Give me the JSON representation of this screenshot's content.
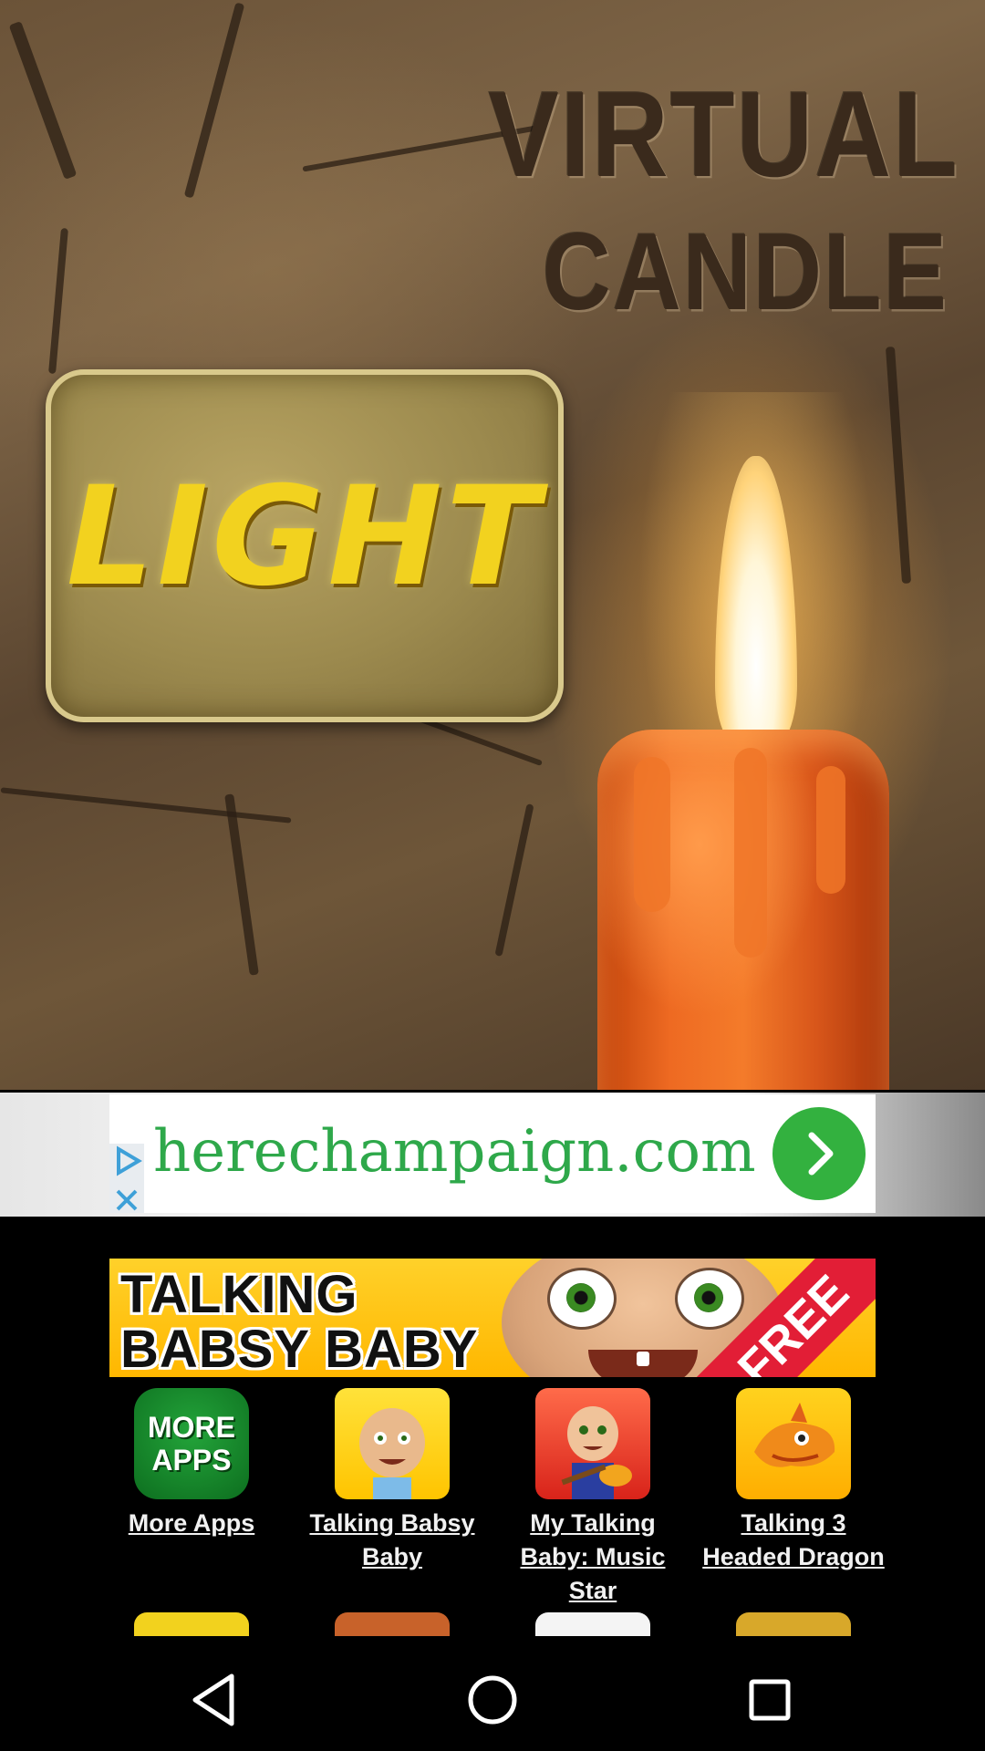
{
  "hero": {
    "title_line1": "VIRTUAL",
    "title_line2": "CANDLE",
    "light_button_label": "LIGHT"
  },
  "ad_banner": {
    "url_text": "herechampaign.com",
    "accent_color": "#33b13f"
  },
  "promo": {
    "title_line1": "TALKING",
    "title_line2": "BABSY BABY",
    "ribbon_text": "FREE"
  },
  "apps": [
    {
      "label": "More Apps",
      "icon_text_line1": "MORE",
      "icon_text_line2": "APPS",
      "icon": "more-apps-icon"
    },
    {
      "label": "Talking Babsy Baby",
      "icon": "baby-icon"
    },
    {
      "label": "My Talking Baby: Music Star",
      "icon": "baby-guitar-icon"
    },
    {
      "label": "Talking 3 Headed Dragon",
      "icon": "dragon-icon"
    }
  ],
  "navbar": {
    "back": "back-icon",
    "home": "home-icon",
    "recents": "recents-icon"
  }
}
